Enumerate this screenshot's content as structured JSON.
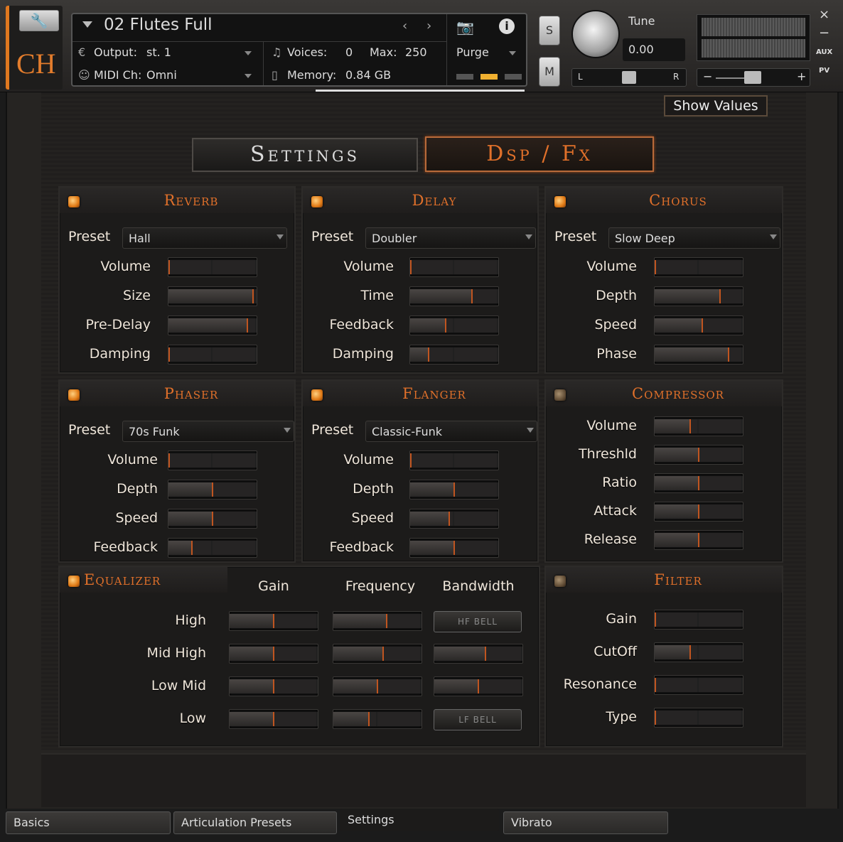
{
  "header": {
    "logo": "CH",
    "instrument_name": "02 Flutes Full",
    "output_label": "Output:",
    "output_value": "st. 1",
    "midi_label": "MIDI Ch:",
    "midi_value": "Omni",
    "voices_label": "Voices:",
    "voices_value": "0",
    "max_label": "Max:",
    "max_value": "250",
    "memory_label": "Memory:",
    "memory_value": "0.84 GB",
    "purge_label": "Purge",
    "s_label": "S",
    "m_label": "M",
    "tune_label": "Tune",
    "tune_value": "0.00",
    "pan_l": "L",
    "pan_r": "R",
    "vol_minus": "−",
    "vol_plus": "+",
    "close": "×",
    "minimize": "−",
    "aux": "AUX",
    "pv": "PV"
  },
  "show_values": "Show Values",
  "mode_tabs": {
    "settings": "Settings",
    "dsp": "Dsp / Fx"
  },
  "preset_label": "Preset",
  "reverb": {
    "title": "Reverb",
    "preset": "Hall",
    "labels": [
      "Volume",
      "Size",
      "Pre-Delay",
      "Damping"
    ],
    "values": [
      0.02,
      0.98,
      0.92,
      0.02
    ]
  },
  "delay": {
    "title": "Delay",
    "preset": "Doubler",
    "labels": [
      "Volume",
      "Time",
      "Feedback",
      "Damping"
    ],
    "values": [
      0.02,
      0.72,
      0.42,
      0.22
    ]
  },
  "chorus": {
    "title": "Chorus",
    "preset": "Slow Deep",
    "labels": [
      "Volume",
      "Depth",
      "Speed",
      "Phase"
    ],
    "values": [
      0.02,
      0.76,
      0.56,
      0.86
    ]
  },
  "phaser": {
    "title": "Phaser",
    "preset": "70s Funk",
    "labels": [
      "Volume",
      "Depth",
      "Speed",
      "Feedback"
    ],
    "values": [
      0.02,
      0.52,
      0.52,
      0.28
    ]
  },
  "flanger": {
    "title": "Flanger",
    "preset": "Classic-Funk",
    "labels": [
      "Volume",
      "Depth",
      "Speed",
      "Feedback"
    ],
    "values": [
      0.02,
      0.52,
      0.46,
      0.52
    ]
  },
  "compressor": {
    "title": "Compressor",
    "labels": [
      "Volume",
      "Threshld",
      "Ratio",
      "Attack",
      "Release"
    ],
    "values": [
      0.42,
      0.52,
      0.52,
      0.52,
      0.52
    ]
  },
  "equalizer": {
    "title": "Equalizer",
    "col_gain": "Gain",
    "col_freq": "Frequency",
    "col_bw": "Bandwidth",
    "rows": [
      "High",
      "Mid High",
      "Low Mid",
      "Low"
    ],
    "gain": [
      0.52,
      0.52,
      0.52,
      0.52
    ],
    "freq": [
      0.62,
      0.58,
      0.52,
      0.42
    ],
    "bw": [
      null,
      0.6,
      0.52,
      null
    ],
    "hf_bell": "HF BELL",
    "lf_bell": "LF BELL"
  },
  "filter": {
    "title": "Filter",
    "labels": [
      "Gain",
      "CutOff",
      "Resonance",
      "Type"
    ],
    "values": [
      0.02,
      0.42,
      0.02,
      0.02
    ]
  },
  "bottom_tabs": [
    "Basics",
    "Articulation Presets",
    "Settings",
    "Vibrato"
  ]
}
